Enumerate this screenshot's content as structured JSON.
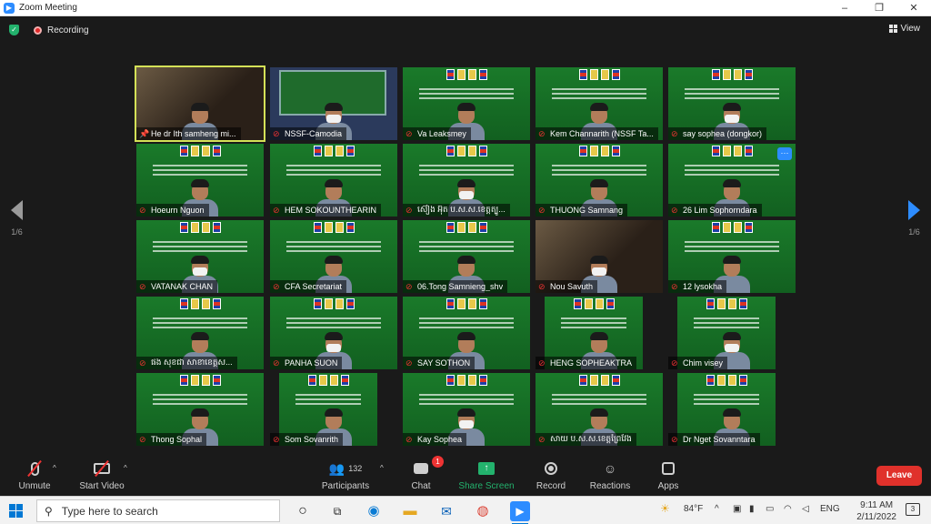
{
  "window": {
    "title": "Zoom Meeting",
    "minimize": "–",
    "maximize": "❐",
    "close": "✕"
  },
  "status": {
    "recording_label": "Recording",
    "view_label": "View"
  },
  "pager": {
    "left_page": "1/6",
    "right_page": "1/6"
  },
  "tiles": [
    {
      "name": "He dr Ith samheng mi...",
      "kind": "webcam-speaker"
    },
    {
      "name": "NSSF-Camodia",
      "kind": "studio"
    },
    {
      "name": "Va Leaksmey",
      "kind": "slide"
    },
    {
      "name": "Kem Channarith (NSSF Ta...",
      "kind": "slide"
    },
    {
      "name": "say sophea (dongkor)",
      "kind": "slide"
    },
    {
      "name": "Hoeurn Nguon",
      "kind": "slide"
    },
    {
      "name": "HEM SOKOUNTHEARIN",
      "kind": "slide"
    },
    {
      "name": "ស៊ៀង អ៊ុត ប.ស.ស.ខេត្តត្បូ...",
      "kind": "slide"
    },
    {
      "name": "THUONG Samnang",
      "kind": "slide"
    },
    {
      "name": "26 Lim Sophorndara",
      "kind": "slide"
    },
    {
      "name": "VATANAK CHAN",
      "kind": "slide"
    },
    {
      "name": "CFA Secretariat",
      "kind": "slide"
    },
    {
      "name": "06.Tong Samnieng_shv",
      "kind": "slide"
    },
    {
      "name": "Nou Savuth",
      "kind": "room"
    },
    {
      "name": "12 lysokha",
      "kind": "slide"
    },
    {
      "name": "ផង សុខជា សាខាខេត្តស...",
      "kind": "slide"
    },
    {
      "name": "PANHA SUON",
      "kind": "slide"
    },
    {
      "name": "SAY SOTHON",
      "kind": "slide"
    },
    {
      "name": "HENG SOPHEAKTRA",
      "kind": "mini"
    },
    {
      "name": "Chim visey",
      "kind": "mini"
    },
    {
      "name": "Thong Sophal",
      "kind": "slide"
    },
    {
      "name": "Som Sovanrith",
      "kind": "mini"
    },
    {
      "name": "Kay Sophea",
      "kind": "slide"
    },
    {
      "name": "សាយ ប.ស.ស.ខេត្តព្រៃវែង",
      "kind": "slide"
    },
    {
      "name": "Dr Nget Sovanntara",
      "kind": "mini"
    }
  ],
  "toolbar": {
    "unmute": "Unmute",
    "start_video": "Start Video",
    "participants": "Participants",
    "participants_count": "132",
    "chat": "Chat",
    "chat_badge": "1",
    "share_screen": "Share Screen",
    "record": "Record",
    "reactions": "Reactions",
    "apps": "Apps",
    "leave": "Leave"
  },
  "taskbar": {
    "search_placeholder": "Type here to search",
    "weather": "84°F",
    "language": "ENG",
    "time": "9:11 AM",
    "date": "2/11/2022",
    "notifications": "3"
  },
  "colors": {
    "accent": "#2d8cff",
    "share_green": "#23b26d",
    "leave_red": "#e0312b",
    "speaker_outline": "#d4e157"
  }
}
